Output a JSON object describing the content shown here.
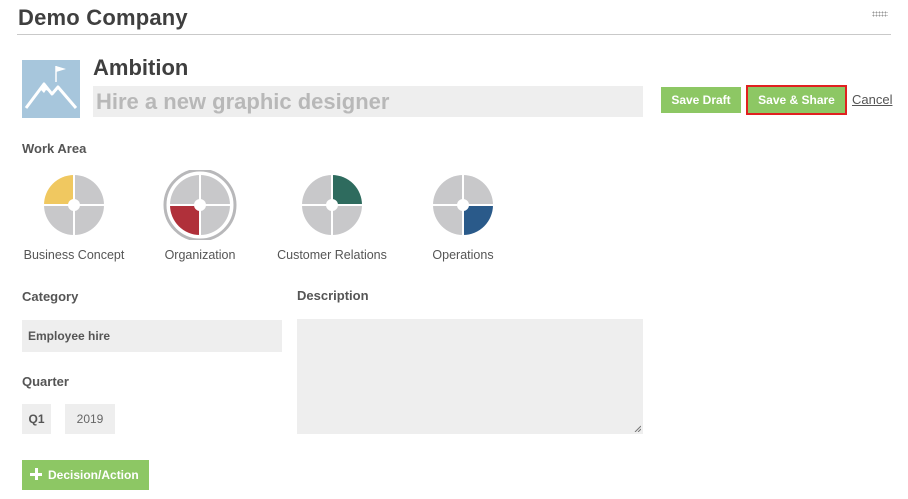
{
  "header": {
    "company_name": "Demo Company"
  },
  "ambition": {
    "label": "Ambition",
    "input_value": "Hire a new graphic designer",
    "icon": "mountain-flag-icon"
  },
  "actions": {
    "save_draft": "Save Draft",
    "save_share": "Save & Share",
    "cancel": "Cancel"
  },
  "work_area": {
    "label": "Work Area",
    "items": [
      {
        "label": "Business Concept",
        "accent": "#f0c860",
        "quadrant": "top-left",
        "selected": false
      },
      {
        "label": "Organization",
        "accent": "#b0303a",
        "quadrant": "bottom-left",
        "selected": true
      },
      {
        "label": "Customer Relations",
        "accent": "#2e6b5e",
        "quadrant": "top-right",
        "selected": false
      },
      {
        "label": "Operations",
        "accent": "#2a5a8a",
        "quadrant": "bottom-right",
        "selected": false
      }
    ]
  },
  "category": {
    "label": "Category",
    "value": "Employee hire"
  },
  "description": {
    "label": "Description",
    "value": ""
  },
  "quarter": {
    "label": "Quarter",
    "quarter_value": "Q1",
    "year_value": "2019"
  },
  "decision_button": {
    "label": "Decision/Action"
  },
  "colors": {
    "green": "#8dc764",
    "highlight": "#e02020",
    "field": "#eeeeee",
    "wheel_gray": "#c8c8ca"
  }
}
